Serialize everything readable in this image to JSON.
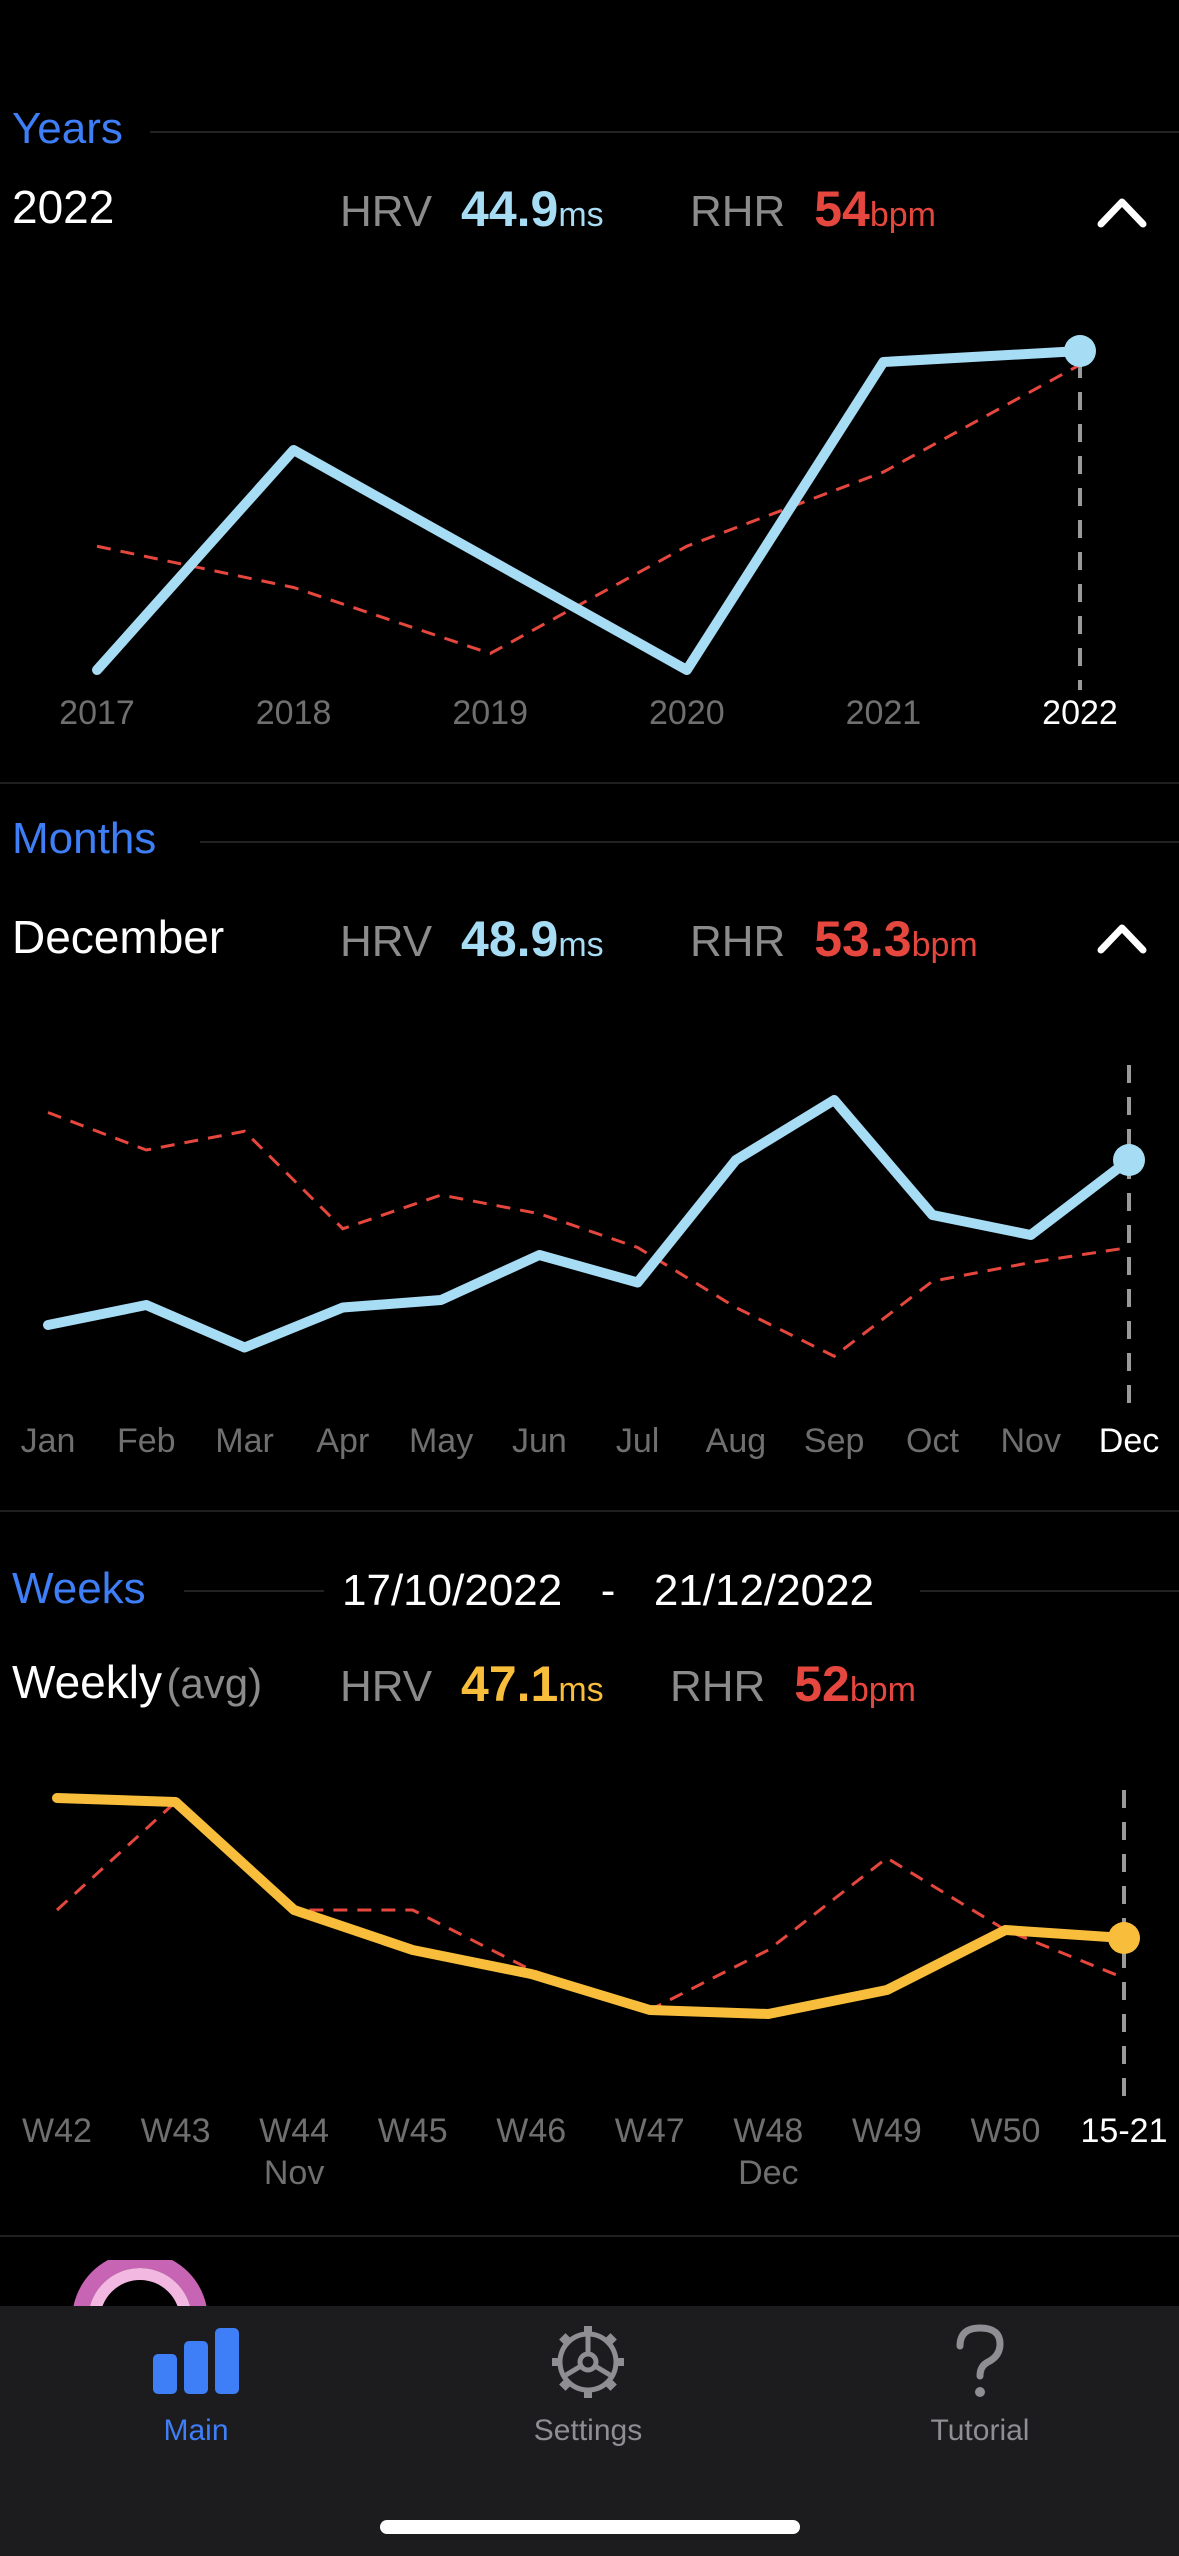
{
  "years": {
    "section_title": "Years",
    "selected_label": "2022",
    "hrv": {
      "label": "HRV",
      "value": "44.9",
      "unit": "ms"
    },
    "rhr": {
      "label": "RHR",
      "value": "54",
      "unit": "bpm"
    },
    "x_labels": [
      "2017",
      "2018",
      "2019",
      "2020",
      "2021",
      "2022"
    ]
  },
  "months": {
    "section_title": "Months",
    "selected_label": "December",
    "hrv": {
      "label": "HRV",
      "value": "48.9",
      "unit": "ms"
    },
    "rhr": {
      "label": "RHR",
      "value": "53.3",
      "unit": "bpm"
    },
    "x_labels": [
      "Jan",
      "Feb",
      "Mar",
      "Apr",
      "May",
      "Jun",
      "Jul",
      "Aug",
      "Sep",
      "Oct",
      "Nov",
      "Dec"
    ]
  },
  "weeks": {
    "section_title": "Weeks",
    "date_start": "17/10/2022",
    "date_sep": "-",
    "date_end": "21/12/2022",
    "selected_label": "Weekly",
    "selected_sub": "(avg)",
    "hrv": {
      "label": "HRV",
      "value": "47.1",
      "unit": "ms"
    },
    "rhr": {
      "label": "RHR",
      "value": "52",
      "unit": "bpm"
    },
    "x_labels": [
      "W42",
      "W43",
      "W44",
      "W45",
      "W46",
      "W47",
      "W48",
      "W49",
      "W50",
      "15-21"
    ],
    "x_sublabels": [
      "",
      "",
      "Nov",
      "",
      "",
      "",
      "Dec",
      "",
      "",
      ""
    ]
  },
  "tabbar": {
    "items": [
      {
        "label": "Main",
        "icon": "bar-chart-icon",
        "active": true
      },
      {
        "label": "Settings",
        "icon": "gear-icon",
        "active": false
      },
      {
        "label": "Tutorial",
        "icon": "question-icon",
        "active": false
      }
    ]
  },
  "colors": {
    "accent": "#3e7ef7",
    "hrv_line": "#a7dcf5",
    "rhr_line": "#e5473e",
    "weekly_hrv_line": "#f7bd3b"
  },
  "chart_data": [
    {
      "type": "line",
      "x": [
        "2017",
        "2018",
        "2019",
        "2020",
        "2021",
        "2022"
      ],
      "series": [
        {
          "name": "HRV",
          "values": [
            42.0,
            44.0,
            43.0,
            42.0,
            44.8,
            44.9
          ]
        },
        {
          "name": "RHR",
          "values": [
            56.5,
            56.0,
            55.2,
            56.5,
            57.4,
            58.7
          ]
        }
      ],
      "xlabel": "",
      "ylabel": ""
    },
    {
      "type": "line",
      "x": [
        "Jan",
        "Feb",
        "Mar",
        "Apr",
        "May",
        "Jun",
        "Jul",
        "Aug",
        "Sep",
        "Oct",
        "Nov",
        "Dec"
      ],
      "series": [
        {
          "name": "HRV",
          "values": [
            40.0,
            40.8,
            39.1,
            40.7,
            41.0,
            42.8,
            41.7,
            46.6,
            49.0,
            44.4,
            43.6,
            46.6
          ]
        },
        {
          "name": "RHR",
          "values": [
            52.0,
            51.0,
            51.5,
            48.9,
            49.8,
            49.3,
            48.4,
            46.8,
            45.5,
            47.5,
            48.0,
            48.4
          ]
        }
      ],
      "xlabel": "",
      "ylabel": ""
    },
    {
      "type": "line",
      "x": [
        "W42",
        "W43",
        "W44",
        "W45",
        "W46",
        "W47",
        "W48",
        "W49",
        "W50",
        "15-21"
      ],
      "series": [
        {
          "name": "HRV",
          "values": [
            51.8,
            51.7,
            49.0,
            48.0,
            47.4,
            46.5,
            46.4,
            47.0,
            48.5,
            48.3
          ]
        },
        {
          "name": "RHR",
          "values": [
            49.0,
            51.7,
            49.0,
            49.0,
            47.5,
            46.5,
            48.0,
            50.3,
            48.5,
            47.3
          ]
        }
      ],
      "xlabel": "",
      "ylabel": ""
    }
  ]
}
